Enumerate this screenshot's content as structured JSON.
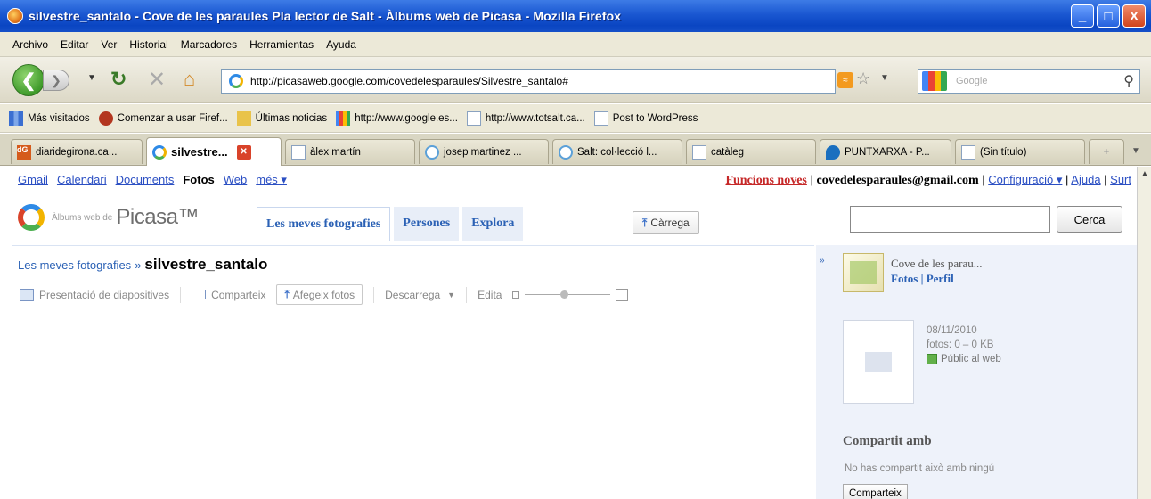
{
  "window": {
    "title": "silvestre_santalo - Cove de les paraules Pla lector de Salt - Àlbums web de Picasa - Mozilla Firefox",
    "buttons": [
      "_",
      "□",
      "X"
    ]
  },
  "menu": [
    "Archivo",
    "Editar",
    "Ver",
    "Historial",
    "Marcadores",
    "Herramientas",
    "Ayuda"
  ],
  "nav": {
    "url": "http://picasaweb.google.com/covedelesparaules/Silvestre_santalo#",
    "search_placeholder": "Google"
  },
  "bookmarks": [
    {
      "label": "Más visitados",
      "icon": "chart-icon"
    },
    {
      "label": "Comenzar a usar Firef...",
      "icon": "firefox-icon"
    },
    {
      "label": "Últimas noticias",
      "icon": "rss-folder-icon"
    },
    {
      "label": "http://www.google.es...",
      "icon": "google-icon"
    },
    {
      "label": "http://www.totsalt.ca...",
      "icon": "page-icon"
    },
    {
      "label": "Post to WordPress",
      "icon": "page-icon"
    }
  ],
  "tabs": [
    {
      "label": "diaridegirona.ca...",
      "icon": "dg"
    },
    {
      "label": "silvestre...",
      "icon": "picasa",
      "active": true
    },
    {
      "label": "àlex martín",
      "icon": "doc"
    },
    {
      "label": "josep martinez ...",
      "icon": "wp"
    },
    {
      "label": "Salt: col·lecció l...",
      "icon": "wp"
    },
    {
      "label": "catàleg",
      "icon": "doc"
    },
    {
      "label": "PUNTXARXA - P...",
      "icon": "px"
    },
    {
      "label": "(Sin título)",
      "icon": "doc"
    }
  ],
  "gbar": {
    "links": [
      "Gmail",
      "Calendari",
      "Documents",
      "Fotos",
      "Web",
      "més ▾"
    ],
    "news": "Funcions noves",
    "email": "covedelesparaules@gmail.com",
    "config": "Configuració ▾",
    "help": "Ajuda",
    "signout": "Surt"
  },
  "picasa": {
    "logo_small": "Àlbums web de",
    "logo_big": "Picasa™",
    "tabs": [
      "Les meves fotografies",
      "Persones",
      "Explora"
    ],
    "upload": "Càrrega",
    "search_button": "Cerca"
  },
  "breadcrumb": {
    "parent": "Les meves fotografies",
    "separator": "»",
    "current": "silvestre_santalo"
  },
  "toolbar": {
    "slideshow": "Presentació de diapositives",
    "share": "Comparteix",
    "add_photos": "Afegeix fotos",
    "download": "Descarrega",
    "edit": "Edita"
  },
  "zoom_level": 0.45,
  "side": {
    "album_title": "Cove de les parau...",
    "album_links": "Fotos | Perfil",
    "date": "08/11/2010",
    "count": "fotos: 0 – 0 KB",
    "visibility": "Públic al web",
    "shared_heading": "Compartit amb",
    "shared_text": "No has compartit això amb ningú",
    "share_button": "Comparteix"
  }
}
